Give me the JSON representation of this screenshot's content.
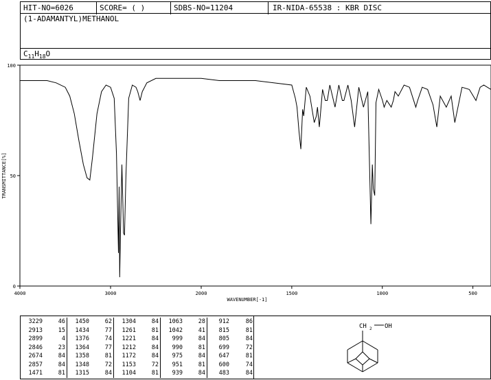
{
  "header": {
    "hit_no": "HIT-NO=6026",
    "score": "SCORE=  (  )",
    "sdbs_no": "SDBS-NO=11204",
    "ir_info": "IR-NIDA-65538 : KBR DISC",
    "compound_name": "(1-ADAMANTYL)METHANOL",
    "formula_parts": [
      "C",
      "11",
      "H",
      "18",
      "O"
    ]
  },
  "chart_data": {
    "type": "line",
    "xlabel": "WAVENUMBER[-1]",
    "ylabel": "TRANSMITTANCE[%]",
    "x_ticks": [
      4000,
      3000,
      2000,
      1500,
      1000,
      500
    ],
    "y_ticks": [
      0,
      50,
      100
    ],
    "xlim": [
      4000,
      400
    ],
    "ylim": [
      0,
      100
    ],
    "series": [
      {
        "x": [
          4000,
          3900,
          3800,
          3700,
          3600,
          3500,
          3450,
          3400,
          3350,
          3300,
          3260,
          3229,
          3200,
          3150,
          3100,
          3050,
          3000,
          2960,
          2935,
          2913,
          2905,
          2899,
          2890,
          2875,
          2860,
          2857,
          2846,
          2830,
          2800,
          2760,
          2720,
          2700,
          2674,
          2650,
          2600,
          2500,
          2400,
          2300,
          2200,
          2100,
          2000,
          1900,
          1800,
          1700,
          1600,
          1500,
          1480,
          1471,
          1460,
          1450,
          1440,
          1434,
          1420,
          1400,
          1376,
          1364,
          1358,
          1348,
          1330,
          1315,
          1304,
          1290,
          1261,
          1240,
          1221,
          1212,
          1190,
          1172,
          1153,
          1130,
          1104,
          1080,
          1063,
          1055,
          1050,
          1042,
          1035,
          1020,
          999,
          990,
          975,
          951,
          939,
          930,
          912,
          880,
          850,
          815,
          805,
          780,
          750,
          720,
          699,
          680,
          647,
          620,
          600,
          560,
          520,
          483,
          460,
          440,
          420,
          400
        ],
        "y": [
          93,
          93,
          93,
          93,
          92,
          90,
          86,
          78,
          66,
          55,
          49,
          48,
          58,
          78,
          88,
          91,
          90,
          85,
          60,
          15,
          45,
          4,
          25,
          55,
          30,
          24,
          23,
          50,
          85,
          91,
          90,
          88,
          84,
          88,
          92,
          94,
          94,
          94,
          94,
          94,
          94,
          93,
          93,
          93,
          92,
          91,
          85,
          81,
          70,
          62,
          80,
          77,
          90,
          86,
          74,
          77,
          81,
          72,
          89,
          84,
          84,
          91,
          81,
          91,
          84,
          84,
          91,
          84,
          72,
          90,
          81,
          88,
          28,
          55,
          44,
          41,
          83,
          89,
          84,
          81,
          84,
          81,
          84,
          88,
          86,
          91,
          90,
          81,
          84,
          90,
          89,
          82,
          72,
          86,
          81,
          86,
          74,
          90,
          89,
          84,
          90,
          91,
          90,
          89
        ]
      }
    ]
  },
  "peak_table": {
    "wavenumbers": [
      [
        "3229",
        "2913",
        "2899",
        "2846",
        "2674",
        "2857",
        "1471"
      ],
      [
        "1450",
        "1434",
        "1376",
        "1364",
        "1358",
        "1348",
        "1315"
      ],
      [
        "1304",
        "1261",
        "1221",
        "1212",
        "1172",
        "1153",
        "1104"
      ],
      [
        "1063",
        "1042",
        "999",
        "990",
        "975",
        "951",
        "939"
      ],
      [
        "912",
        "815",
        "805",
        "699",
        "647",
        "600",
        "483"
      ]
    ],
    "transmittances": [
      [
        "46",
        "15",
        "4",
        "23",
        "84",
        "84",
        "81"
      ],
      [
        "62",
        "77",
        "74",
        "77",
        "81",
        "72",
        "84"
      ],
      [
        "84",
        "81",
        "84",
        "84",
        "84",
        "72",
        "81"
      ],
      [
        "28",
        "41",
        "84",
        "81",
        "84",
        "81",
        "84"
      ],
      [
        "86",
        "81",
        "84",
        "72",
        "81",
        "74",
        "84"
      ]
    ]
  },
  "structure": {
    "label_ch2": "CH",
    "label_sub": "2",
    "label_oh": "OH"
  }
}
